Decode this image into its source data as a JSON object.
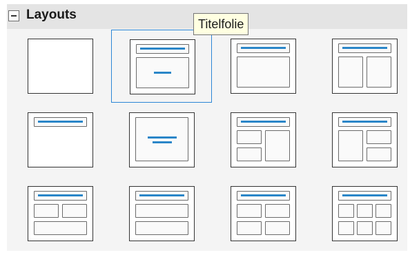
{
  "panel": {
    "title": "Layouts",
    "collapse_icon": "minus-box-icon",
    "tooltip": "Titelfolie",
    "selected_index": 1,
    "accent_color": "#2a86c8",
    "layouts": [
      {
        "id": "blank",
        "icon": "blank-slide-icon"
      },
      {
        "id": "title-slide",
        "icon": "title-slide-layout-icon"
      },
      {
        "id": "title-content",
        "icon": "title-content-layout-icon"
      },
      {
        "id": "title-two-content",
        "icon": "title-two-content-layout-icon"
      },
      {
        "id": "title-only",
        "icon": "title-only-layout-icon"
      },
      {
        "id": "centered-text",
        "icon": "centered-text-layout-icon"
      },
      {
        "id": "title-two-content-right",
        "icon": "title-content-two-content-layout-icon"
      },
      {
        "id": "title-two-content-left",
        "icon": "title-two-content-content-layout-icon"
      },
      {
        "id": "title-two-over-one",
        "icon": "title-two-content-over-content-layout-icon"
      },
      {
        "id": "title-content-over-content",
        "icon": "title-content-over-content-layout-icon"
      },
      {
        "id": "title-four-content",
        "icon": "title-four-content-layout-icon"
      },
      {
        "id": "title-six-content",
        "icon": "title-six-content-layout-icon"
      }
    ]
  }
}
